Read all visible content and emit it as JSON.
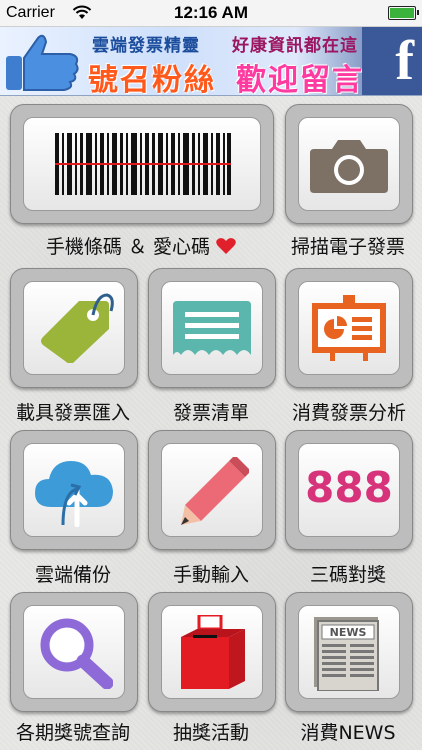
{
  "status_bar": {
    "carrier": "Carrier",
    "time": "12:16 AM"
  },
  "banner": {
    "line1_left": "雲端發票精靈",
    "line1_right": "好康資訊都在這",
    "line2_left": "號召粉絲",
    "line2_right": "歡迎留言",
    "brand_letter": "f"
  },
  "tiles": [
    {
      "label": "手機條碼 ＆ 愛心碼",
      "icon": "barcode-icon"
    },
    {
      "label": "掃描電子發票",
      "icon": "camera-icon"
    },
    {
      "label": "載具發票匯入",
      "icon": "tag-icon"
    },
    {
      "label": "發票清單",
      "icon": "receipt-icon"
    },
    {
      "label": "消費發票分析",
      "icon": "presentation-icon"
    },
    {
      "label": "雲端備份",
      "icon": "cloud-upload-icon"
    },
    {
      "label": "手動輸入",
      "icon": "pencil-icon"
    },
    {
      "label": "三碼對獎",
      "icon": "888-icon",
      "icon_text": "888"
    },
    {
      "label": "各期獎號查詢",
      "icon": "magnifier-icon"
    },
    {
      "label": "抽獎活動",
      "icon": "lottery-box-icon"
    },
    {
      "label": "消費NEWS",
      "icon": "newspaper-icon",
      "icon_text": "NEWS"
    }
  ],
  "colors": {
    "heart": "#e0202a",
    "tag": "#9bb43a",
    "receipt": "#5bb7ad",
    "presentation": "#e8631f",
    "cloud": "#3d9bd8",
    "pencil": "#ec6a76",
    "number": "#d6337a",
    "magnifier": "#8d6ad8",
    "box": "#e31b23",
    "camera": "#7d7166"
  }
}
